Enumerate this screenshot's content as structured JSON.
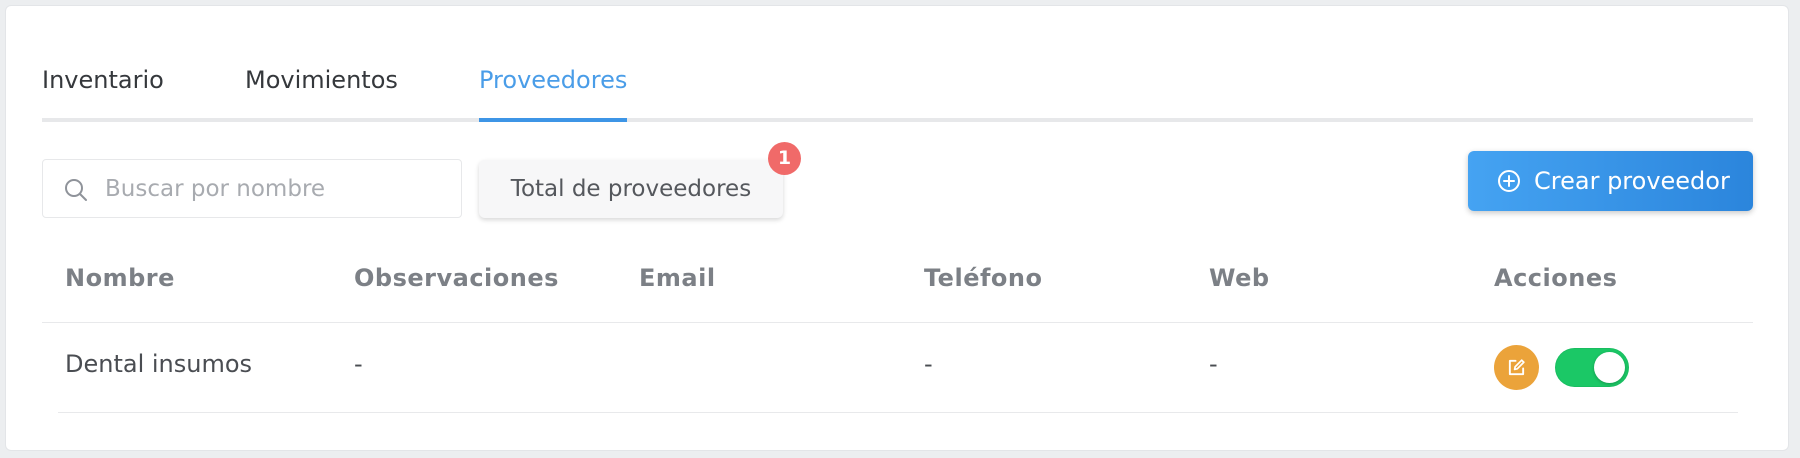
{
  "tabs": [
    {
      "label": "Inventario",
      "active": false
    },
    {
      "label": "Movimientos",
      "active": false
    },
    {
      "label": "Proveedores",
      "active": true
    }
  ],
  "search": {
    "placeholder": "Buscar por nombre",
    "value": "",
    "icon": "search-icon"
  },
  "total": {
    "label": "Total de proveedores",
    "count": "1"
  },
  "create_button": {
    "label": "Crear proveedor",
    "icon": "plus-circle-icon"
  },
  "table": {
    "columns": [
      "Nombre",
      "Observaciones",
      "Email",
      "Teléfono",
      "Web",
      "Acciones"
    ],
    "rows": [
      {
        "nombre": "Dental insumos",
        "observaciones": "-",
        "email": "",
        "telefono": "-",
        "web": "-",
        "active": true
      }
    ]
  },
  "colors": {
    "accent": "#3d95e6",
    "badge": "#f06a69",
    "edit": "#eba33a",
    "toggle_on": "#1bc866"
  }
}
